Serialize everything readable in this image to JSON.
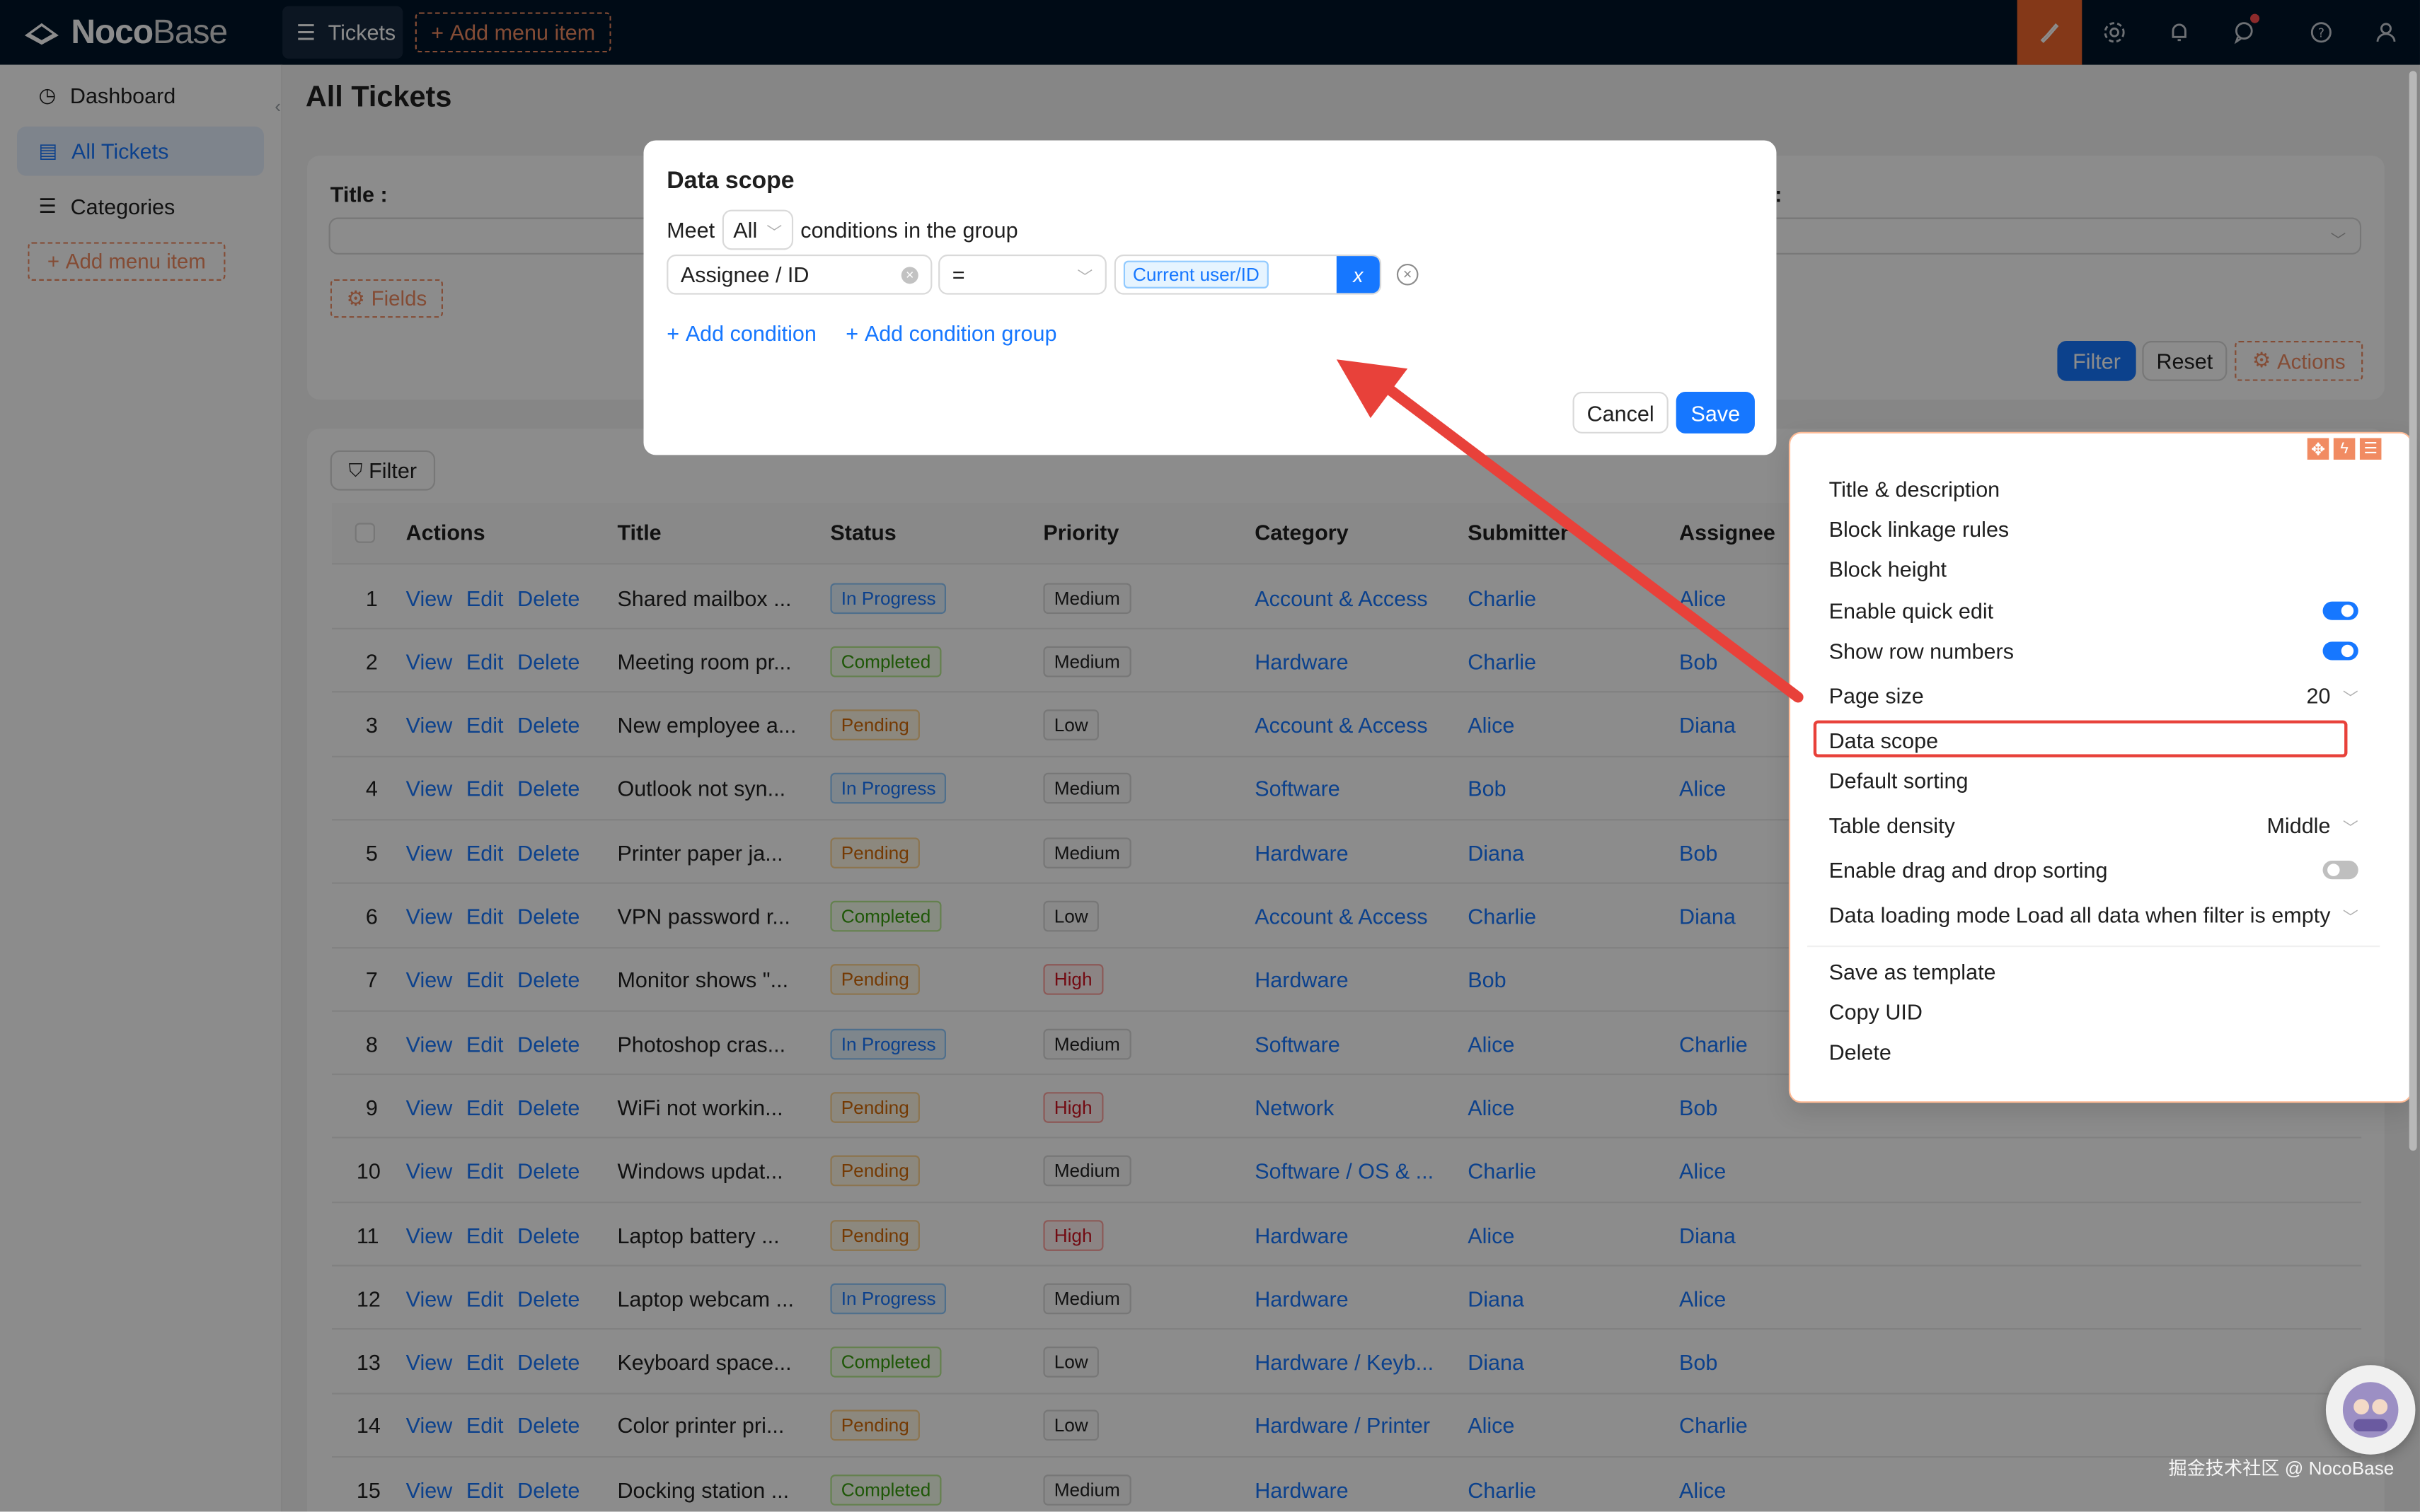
{
  "topbar": {
    "logo_bold": "Noco",
    "logo_light": "Base",
    "menu_tickets": "Tickets",
    "add_menu_item": "Add menu item",
    "icons": [
      "brush-icon",
      "gear-icon",
      "bell-icon",
      "chat-icon",
      "help-icon",
      "user-icon"
    ],
    "accent_color": "#f0662d"
  },
  "sidebar": {
    "items": [
      {
        "label": "Dashboard",
        "icon": "dashboard-icon"
      },
      {
        "label": "All Tickets",
        "icon": "document-icon"
      },
      {
        "label": "Categories",
        "icon": "list-icon"
      }
    ],
    "add_menu_item": "Add menu item"
  },
  "page": {
    "title": "All Tickets",
    "filter_form": {
      "title_label": "Title :",
      "right_label_fragment": ":",
      "fields_button": "Fields",
      "filter_button": "Filter",
      "reset_button": "Reset",
      "actions_button": "Actions"
    },
    "table": {
      "filter_button": "Filter",
      "columns": [
        "Actions",
        "Title",
        "Status",
        "Priority",
        "Category",
        "Submitter",
        "Assignee"
      ],
      "action_links": [
        "View",
        "Edit",
        "Delete"
      ],
      "rows": [
        {
          "no": "1",
          "title": "Shared mailbox ...",
          "status": "In Progress",
          "priority": "Medium",
          "category": "Account & Access",
          "submitter": "Charlie",
          "assignee": "Alice"
        },
        {
          "no": "2",
          "title": "Meeting room pr...",
          "status": "Completed",
          "priority": "Medium",
          "category": "Hardware",
          "submitter": "Charlie",
          "assignee": "Bob"
        },
        {
          "no": "3",
          "title": "New employee a...",
          "status": "Pending",
          "priority": "Low",
          "category": "Account & Access",
          "submitter": "Alice",
          "assignee": "Diana"
        },
        {
          "no": "4",
          "title": "Outlook not syn...",
          "status": "In Progress",
          "priority": "Medium",
          "category": "Software",
          "submitter": "Bob",
          "assignee": "Alice"
        },
        {
          "no": "5",
          "title": "Printer paper ja...",
          "status": "Pending",
          "priority": "Medium",
          "category": "Hardware",
          "submitter": "Diana",
          "assignee": "Bob"
        },
        {
          "no": "6",
          "title": "VPN password r...",
          "status": "Completed",
          "priority": "Low",
          "category": "Account & Access",
          "submitter": "Charlie",
          "assignee": "Diana"
        },
        {
          "no": "7",
          "title": "Monitor shows \"...",
          "status": "Pending",
          "priority": "High",
          "category": "Hardware",
          "submitter": "Bob",
          "assignee": ""
        },
        {
          "no": "8",
          "title": "Photoshop cras...",
          "status": "In Progress",
          "priority": "Medium",
          "category": "Software",
          "submitter": "Alice",
          "assignee": "Charlie"
        },
        {
          "no": "9",
          "title": "WiFi not workin...",
          "status": "Pending",
          "priority": "High",
          "category": "Network",
          "submitter": "Alice",
          "assignee": "Bob"
        },
        {
          "no": "10",
          "title": "Windows updat...",
          "status": "Pending",
          "priority": "Medium",
          "category": "Software / OS & ...",
          "submitter": "Charlie",
          "assignee": "Alice"
        },
        {
          "no": "11",
          "title": "Laptop battery ...",
          "status": "Pending",
          "priority": "High",
          "category": "Hardware",
          "submitter": "Alice",
          "assignee": "Diana"
        },
        {
          "no": "12",
          "title": "Laptop webcam ...",
          "status": "In Progress",
          "priority": "Medium",
          "category": "Hardware",
          "submitter": "Diana",
          "assignee": "Alice"
        },
        {
          "no": "13",
          "title": "Keyboard space...",
          "status": "Completed",
          "priority": "Low",
          "category": "Hardware / Keyb...",
          "submitter": "Diana",
          "assignee": "Bob"
        },
        {
          "no": "14",
          "title": "Color printer pri...",
          "status": "Pending",
          "priority": "Low",
          "category": "Hardware / Printer",
          "submitter": "Alice",
          "assignee": "Charlie"
        },
        {
          "no": "15",
          "title": "Docking station ...",
          "status": "Completed",
          "priority": "Medium",
          "category": "Hardware",
          "submitter": "Charlie",
          "assignee": "Alice"
        }
      ]
    }
  },
  "modal": {
    "title": "Data scope",
    "meet_prefix": "Meet",
    "meet_value": "All",
    "meet_suffix": "conditions in the group",
    "condition": {
      "field": "Assignee / ID",
      "operator": "=",
      "value_tag": "Current user/ID",
      "variable_button": "x"
    },
    "add_condition": "Add condition",
    "add_condition_group": "Add condition group",
    "cancel": "Cancel",
    "save": "Save"
  },
  "settings_menu": {
    "items": {
      "title_desc": "Title & description",
      "linkage": "Block linkage rules",
      "height": "Block height",
      "quick_edit": "Enable quick edit",
      "row_numbers": "Show row numbers",
      "page_size": "Page size",
      "page_size_value": "20",
      "data_scope": "Data scope",
      "default_sorting": "Default sorting",
      "density": "Table density",
      "density_value": "Middle",
      "drag_sort": "Enable drag and drop sorting",
      "loading_mode": "Data loading mode",
      "loading_mode_value": "Load all data when filter is empty",
      "save_template": "Save as template",
      "copy_uid": "Copy UID",
      "delete": "Delete"
    },
    "toggles": {
      "quick_edit": true,
      "row_numbers": true,
      "drag_sort": false
    }
  },
  "watermark": "掘金技术社区 @ NocoBase",
  "colors": {
    "primary": "#1677ff",
    "annotation_red": "#e8413a"
  }
}
